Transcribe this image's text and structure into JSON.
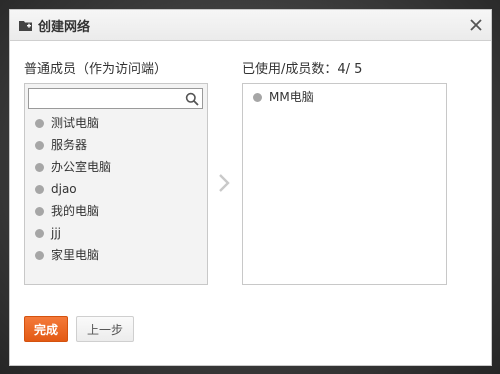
{
  "dialog": {
    "title": "创建网络",
    "close_glyph": "✕"
  },
  "left_panel": {
    "label": "普通成员（作为访问端）",
    "search_placeholder": "",
    "items": [
      {
        "label": "测试电脑"
      },
      {
        "label": "服务器"
      },
      {
        "label": "办公室电脑"
      },
      {
        "label": "djao"
      },
      {
        "label": "我的电脑"
      },
      {
        "label": "jjj"
      },
      {
        "label": "家里电脑"
      }
    ]
  },
  "right_panel": {
    "label": "已使用/成员数：4/ 5",
    "items": [
      {
        "label": "MM电脑"
      }
    ]
  },
  "buttons": {
    "done": "完成",
    "prev": "上一步"
  },
  "colors": {
    "accent": "#e8621f",
    "status_dot": "#a6a6a6"
  },
  "icons": {
    "title": "network-folder-icon",
    "close": "close-icon",
    "search": "search-icon",
    "move": "chevron-right-icon"
  }
}
